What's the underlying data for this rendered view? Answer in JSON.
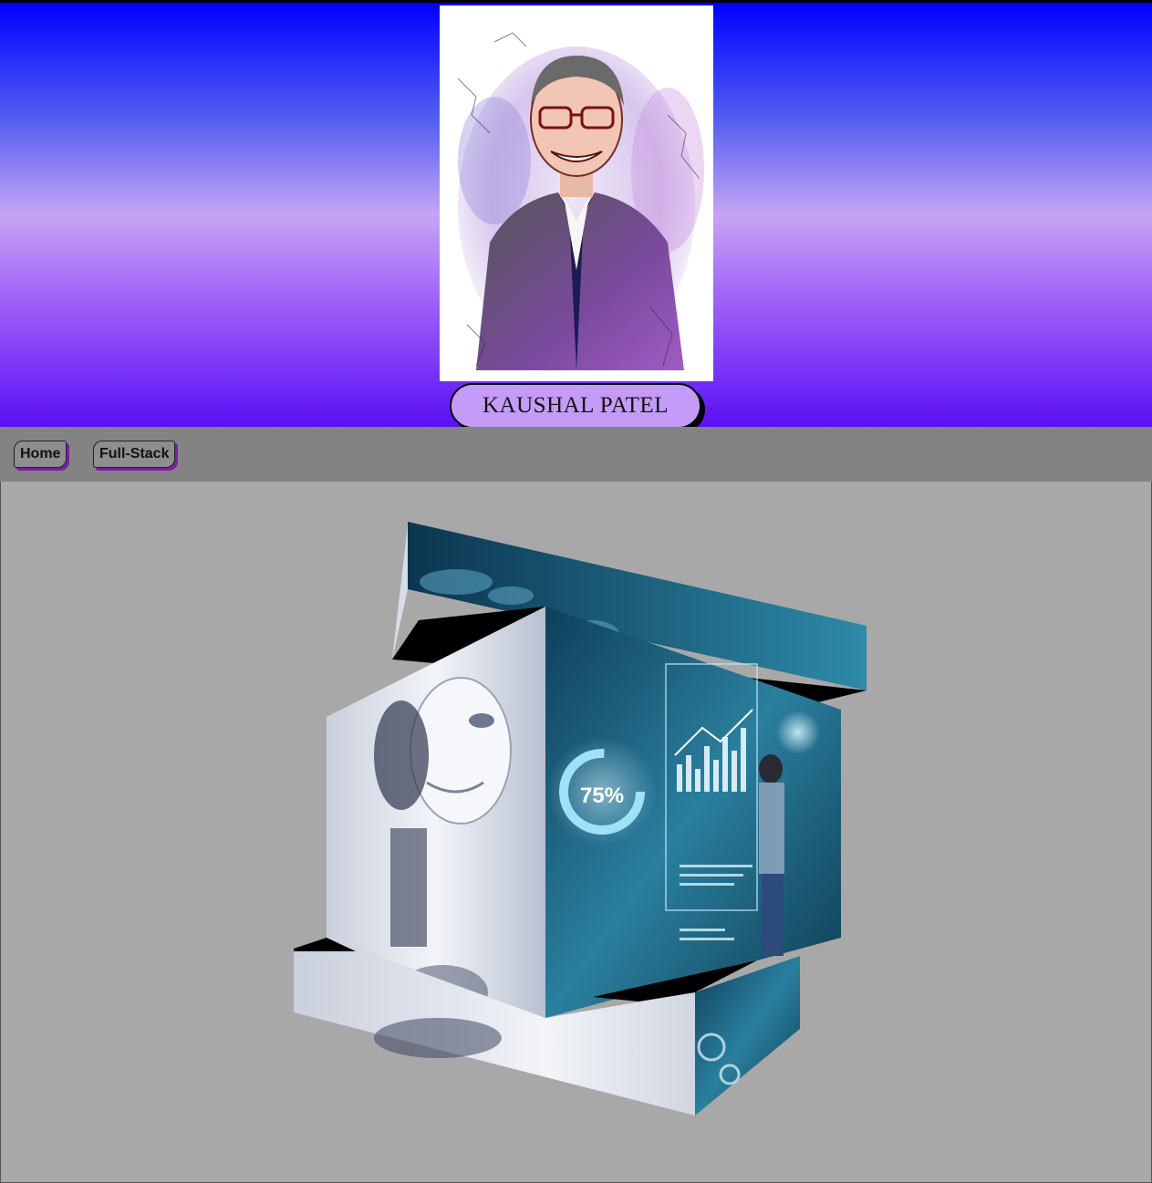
{
  "header": {
    "name": "KAUSHAL PATEL",
    "portrait_icon": "sketch-portrait-image"
  },
  "nav": {
    "items": [
      {
        "label": "Home"
      },
      {
        "label": "Full-Stack"
      }
    ]
  },
  "cube": {
    "face_front_label": "75%",
    "colors": {
      "tech": "#1d5a78",
      "robot": "#e4e8f0",
      "edge": "#000000"
    }
  }
}
